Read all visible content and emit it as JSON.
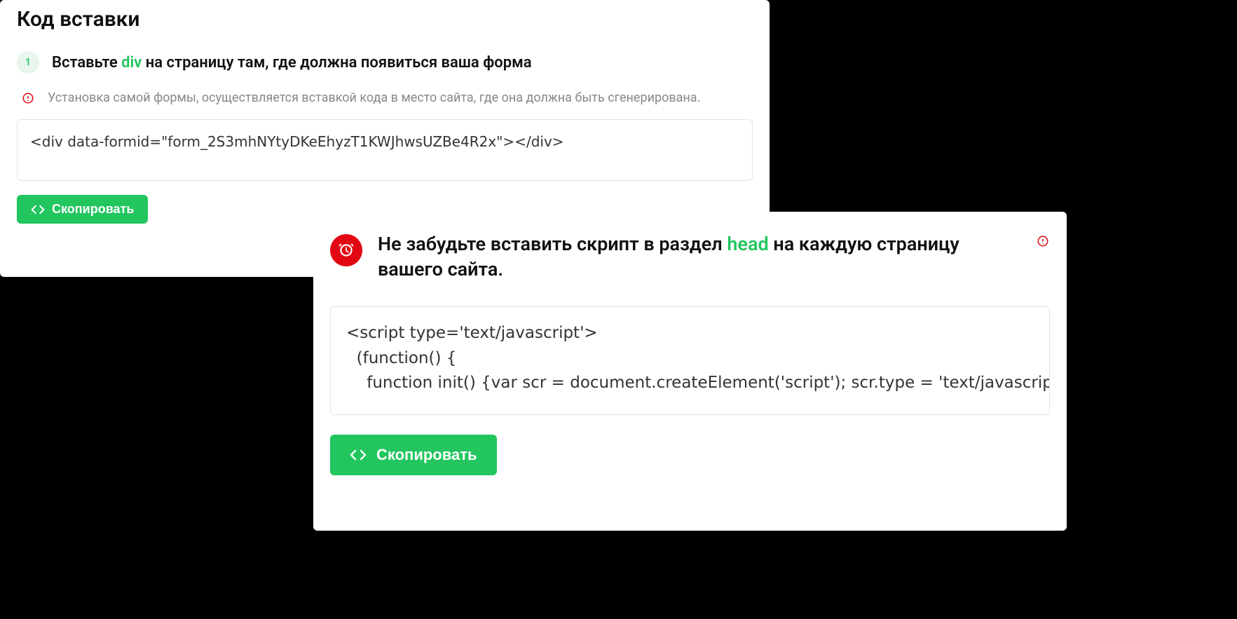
{
  "card_a": {
    "title": "Код вставки",
    "step_number": "1",
    "step_text_before": "Вставьте ",
    "step_keyword": "div",
    "step_text_after": " на страницу там, где должна появиться ваша форма",
    "info_text": "Установка самой формы, осуществляется вставкой кода в место сайта, где она должна быть сгенерирована.",
    "code": "<div data-formid=\"form_2S3mhNYtyDKeEhyzT1KWJhwsUZBe4R2x\"></div>",
    "copy_label": "Скопировать"
  },
  "card_b": {
    "heading_before": "Не забудьте вставить скрипт в раздел ",
    "heading_keyword": "head",
    "heading_after": " на каждую страницу вашего сайта.",
    "script_code": "<script type='text/javascript'>\n  (function() {\n    function init() {var scr = document.createElement('script'); scr.type = 'text/javascript'; scr.defer = 'defer'; scr.src = '//cdn.qform.io/forms.js?v=' +",
    "copy_label": "Скопировать"
  }
}
